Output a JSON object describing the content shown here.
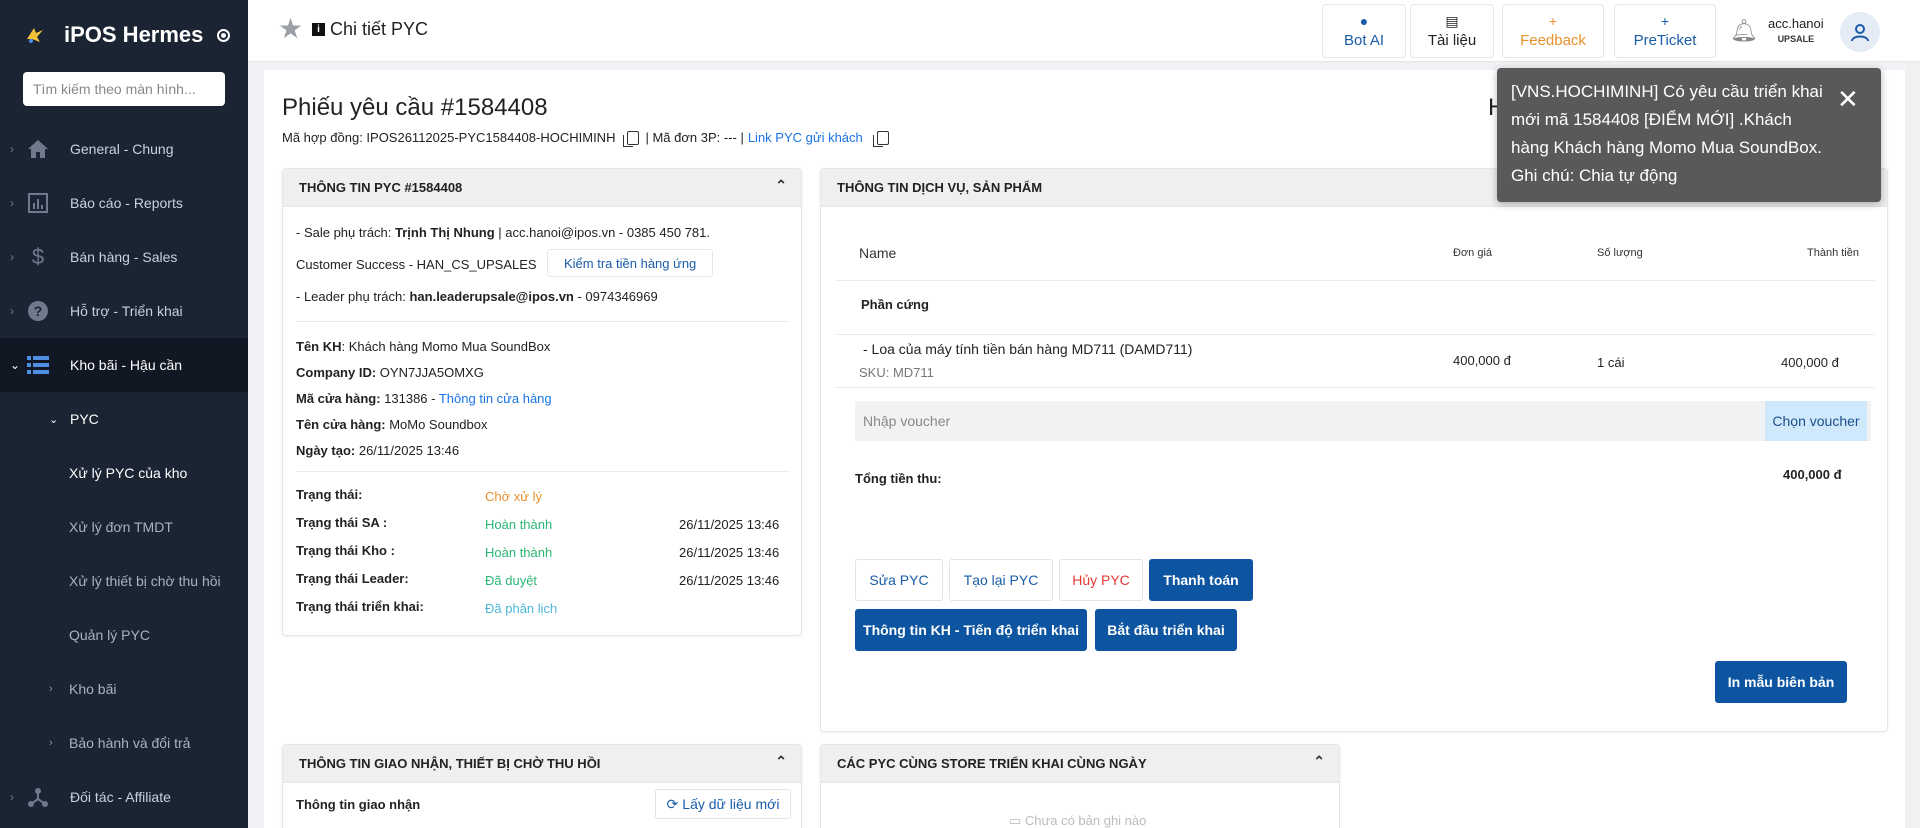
{
  "sidebar": {
    "brand": "iPOS Hermes",
    "search_placeholder": "Tìm kiếm theo màn hình...",
    "items": [
      {
        "label": "General - Chung"
      },
      {
        "label": "Báo cáo - Reports"
      },
      {
        "label": "Bán hàng - Sales"
      },
      {
        "label": "Hỗ trợ - Triển khai"
      },
      {
        "label": "Kho bãi - Hậu cần"
      }
    ],
    "sub": {
      "pyc": "PYC",
      "items": [
        "Xử lý PYC của kho",
        "Xử lý đơn TMDT",
        "Xử lý thiết bị chờ thu hồi",
        "Quản lý PYC"
      ],
      "kho_bai": "Kho bãi",
      "bao_hanh": "Bảo hành và đổi trả"
    },
    "affiliate": "Đối tác - Affiliate"
  },
  "topbar": {
    "title": "Chi tiết PYC",
    "bot": "Bot AI",
    "docs": "Tài liệu",
    "feedback": "Feedback",
    "preticket": "PreTicket",
    "account": "acc.hanoi",
    "role": "UPSALE"
  },
  "page": {
    "heading": "Phiếu yêu cầu #1584408",
    "contract_label": "Mã hợp đồng: IPOS26112025-PYC1584408-HOCHIMINH",
    "order3p": "| Mã đơn 3P: --- |",
    "link_pyc": "Link PYC gửi khách",
    "h_letter": "H"
  },
  "info": {
    "title": "THÔNG TIN PYC #1584408",
    "sale_prefix": "- Sale phụ trách: ",
    "sale_name": "Trịnh Thị Nhung",
    "sale_rest": " | acc.hanoi@ipos.vn - 0385 450 781.",
    "cs": "Customer Success - HAN_CS_UPSALES",
    "check_btn": "Kiểm tra tiền hàng ứng",
    "leader_prefix": "- Leader phụ trách: ",
    "leader_name": "han.leaderupsale@ipos.vn",
    "leader_rest": " - 0974346969",
    "kh_label": "Tên KH",
    "kh_value": ": Khách hàng Momo Mua SoundBox",
    "company_label": "Company ID:",
    "company_value": " OYN7JJA5OMXG",
    "store_code_label": "Mã cửa hàng:",
    "store_code_value": " 131386 - ",
    "store_link": "Thông tin cửa hàng",
    "store_name_label": "Tên cửa hàng:",
    "store_name_value": " MoMo Soundbox",
    "created_label": "Ngày tạo:",
    "created_value": " 26/11/2025 13:46",
    "statuses": [
      {
        "label": "Trạng thái:",
        "value": "Chờ xử lý",
        "date": "",
        "color": "#e8912d"
      },
      {
        "label": "Trạng thái SA :",
        "value": "Hoàn thành",
        "date": "26/11/2025 13:46",
        "color": "#2bb673"
      },
      {
        "label": "Trạng thái Kho :",
        "value": "Hoàn thành",
        "date": "26/11/2025 13:46",
        "color": "#2bb673"
      },
      {
        "label": "Trạng thái Leader:",
        "value": "Đã duyệt",
        "date": "26/11/2025 13:46",
        "color": "#2bb673"
      },
      {
        "label": "Trạng thái triển khai:",
        "value": "Đã phân lịch",
        "date": "",
        "color": "#4fb6d8"
      }
    ]
  },
  "service": {
    "title": "THÔNG TIN DỊCH VỤ, SẢN PHẨM",
    "col_name": "Name",
    "col_price": "Đơn giá",
    "col_qty": "Số lượng",
    "col_total": "Thành tiền",
    "group": "Phần cứng",
    "product_name": "- Loa của máy tính tiền bán hàng MD711 (DAMD711)",
    "product_sku": "SKU: MD711",
    "product_price": "400,000 đ",
    "product_qty": "1 cái",
    "product_total": "400,000 đ",
    "voucher_placeholder": "Nhập voucher",
    "voucher_btn": "Chọn voucher",
    "total_label": "Tổng tiền thu:",
    "total_value": "400,000 đ",
    "btn_edit": "Sửa PYC",
    "btn_recreate": "Tạo lại PYC",
    "btn_cancel": "Hủy PYC",
    "btn_pay": "Thanh toán",
    "btn_progress": "Thông tin KH - Tiến độ triển khai",
    "btn_start": "Bắt đầu triển khai",
    "btn_print": "In mẫu biên bản"
  },
  "delivery": {
    "title": "THÔNG TIN GIAO NHẬN, THIẾT BỊ CHỜ THU HỒI",
    "label": "Thông tin giao nhận",
    "refresh": "Lấy dữ liệu mới"
  },
  "same_store": {
    "title": "CÁC PYC CÙNG STORE TRIỂN KHAI CÙNG NGÀY",
    "empty": "Chưa có bản ghi nào"
  },
  "toast": {
    "message": "[VNS.HOCHIMINH] Có yêu cầu triển khai mới mã 1584408 [ĐIỂM MỚI] .Khách hàng Khách hàng Momo Mua SoundBox. Ghi chú: Chia tự động"
  }
}
